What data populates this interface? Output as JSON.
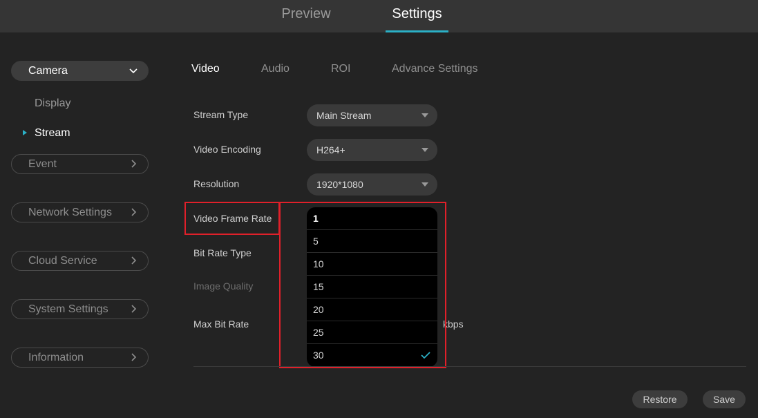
{
  "header": {
    "tabs": [
      {
        "label": "Preview"
      },
      {
        "label": "Settings"
      }
    ]
  },
  "sidebar": {
    "camera": {
      "label": "Camera",
      "items": [
        {
          "label": "Display"
        },
        {
          "label": "Stream"
        }
      ]
    },
    "groups": [
      {
        "label": "Event"
      },
      {
        "label": "Network Settings"
      },
      {
        "label": "Cloud Service"
      },
      {
        "label": "System Settings"
      },
      {
        "label": "Information"
      }
    ]
  },
  "subtabs": [
    {
      "label": "Video"
    },
    {
      "label": "Audio"
    },
    {
      "label": "ROI"
    },
    {
      "label": "Advance Settings"
    }
  ],
  "form": {
    "stream_type": {
      "label": "Stream Type",
      "value": "Main Stream"
    },
    "video_encoding": {
      "label": "Video Encoding",
      "value": "H264+"
    },
    "resolution": {
      "label": "Resolution",
      "value": "1920*1080"
    },
    "video_frame_rate": {
      "label": "Video Frame Rate"
    },
    "bit_rate_type": {
      "label": "Bit Rate Type"
    },
    "image_quality": {
      "label": "Image Quality"
    },
    "max_bit_rate": {
      "label": "Max Bit Rate",
      "unit": "kbps"
    }
  },
  "frame_rate_options": [
    "1",
    "5",
    "10",
    "15",
    "20",
    "25",
    "30"
  ],
  "frame_rate_selected": "30",
  "buttons": {
    "restore": "Restore",
    "save": "Save"
  },
  "colors": {
    "accent": "#2bb0c6",
    "highlight": "#e0202a"
  }
}
